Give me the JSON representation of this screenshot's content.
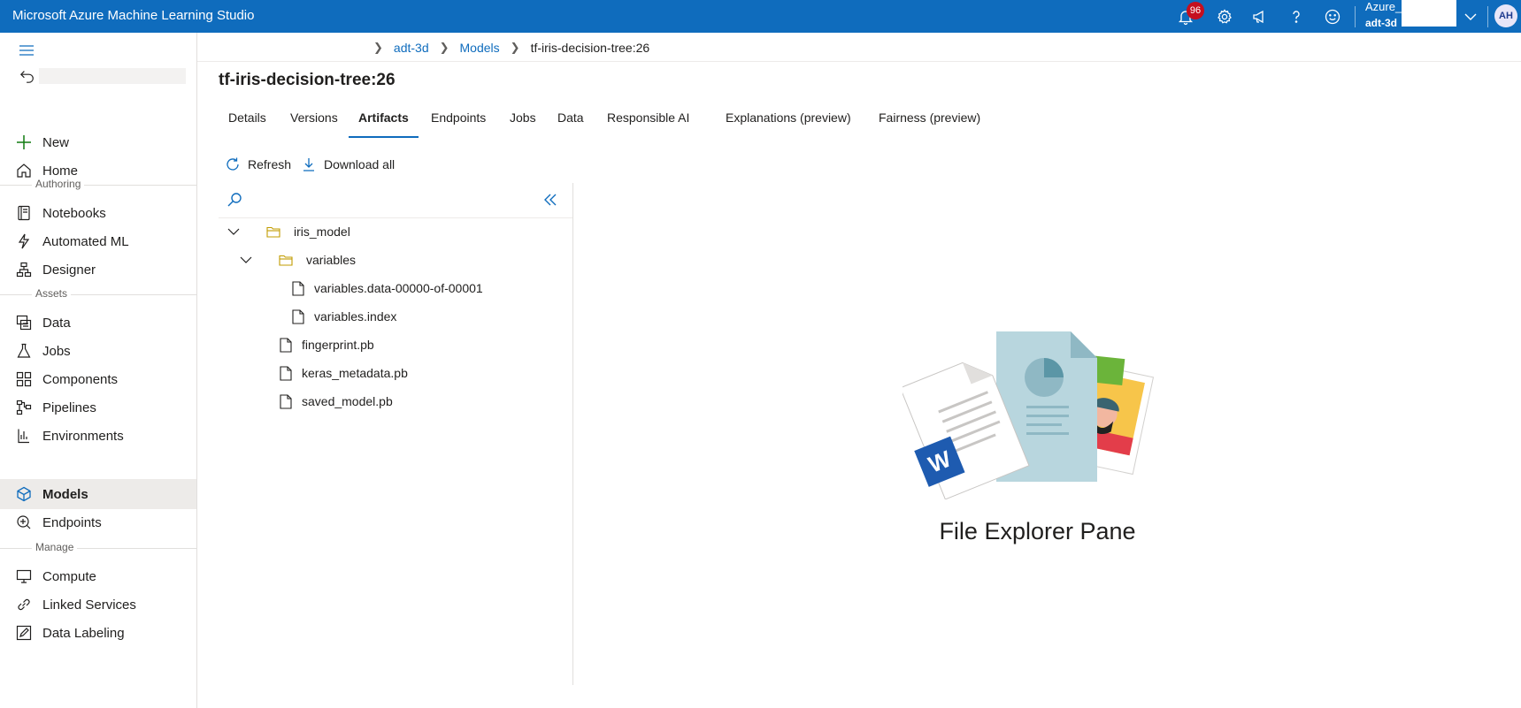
{
  "app": {
    "title": "Microsoft Azure Machine Learning Studio",
    "notification_count": "96",
    "account_name": "Azure_",
    "workspace": "adt-3d",
    "avatar_initials": "AH",
    "header_color": "#0f6cbd",
    "icons": [
      "bell-icon",
      "gear-icon",
      "megaphone-icon",
      "help-icon",
      "smiley-icon",
      "chevron-down-icon"
    ]
  },
  "sidebar": {
    "top": [
      {
        "label": "New",
        "icon": "plus-icon"
      },
      {
        "label": "Home",
        "icon": "home-icon"
      }
    ],
    "sections": [
      {
        "title": "Authoring",
        "items": [
          {
            "label": "Notebooks",
            "icon": "notebook-icon"
          },
          {
            "label": "Automated ML",
            "icon": "automl-icon"
          },
          {
            "label": "Designer",
            "icon": "designer-icon"
          }
        ]
      },
      {
        "title": "Assets",
        "items": [
          {
            "label": "Data",
            "icon": "data-icon"
          },
          {
            "label": "Jobs",
            "icon": "flask-icon"
          },
          {
            "label": "Components",
            "icon": "components-icon"
          },
          {
            "label": "Pipelines",
            "icon": "pipelines-icon"
          },
          {
            "label": "Environments",
            "icon": "environments-icon"
          },
          {
            "label": "Models",
            "icon": "cube-icon",
            "active": true
          },
          {
            "label": "Endpoints",
            "icon": "endpoints-icon"
          }
        ]
      },
      {
        "title": "Manage",
        "items": [
          {
            "label": "Compute",
            "icon": "compute-icon"
          },
          {
            "label": "Linked Services",
            "icon": "link-icon"
          },
          {
            "label": "Data Labeling",
            "icon": "labeling-icon"
          }
        ]
      }
    ]
  },
  "breadcrumb": {
    "workspace": "adt-3d",
    "models": "Models",
    "current": "tf-iris-decision-tree:26"
  },
  "page": {
    "title": "tf-iris-decision-tree:26"
  },
  "tabs": [
    "Details",
    "Versions",
    "Artifacts",
    "Endpoints",
    "Jobs",
    "Data",
    "Responsible AI",
    "Explanations (preview)",
    "Fairness (preview)"
  ],
  "active_tab": "Artifacts",
  "commands": {
    "refresh": "Refresh",
    "download_all": "Download all"
  },
  "tree": [
    {
      "name": "iris_model",
      "type": "folder",
      "expanded": true
    },
    {
      "name": "variables",
      "type": "folder",
      "expanded": true
    },
    {
      "name": "variables.data-00000-of-00001",
      "type": "file"
    },
    {
      "name": "variables.index",
      "type": "file"
    },
    {
      "name": "fingerprint.pb",
      "type": "file"
    },
    {
      "name": "keras_metadata.pb",
      "type": "file"
    },
    {
      "name": "saved_model.pb",
      "type": "file"
    }
  ],
  "explorer": {
    "label": "File Explorer Pane"
  }
}
